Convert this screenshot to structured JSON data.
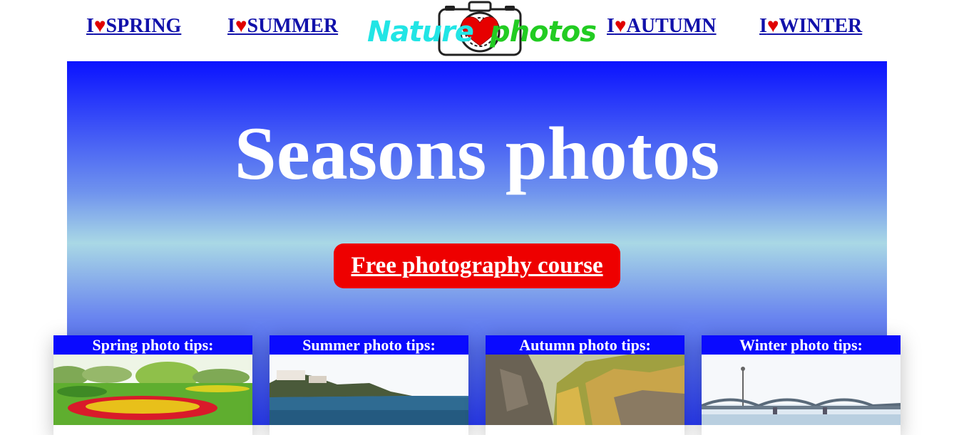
{
  "nav": {
    "spring": {
      "prefix": "I",
      "heart": "♥",
      "label": "SPRING"
    },
    "summer": {
      "prefix": "I",
      "heart": "♥",
      "label": "SUMMER"
    },
    "autumn": {
      "prefix": "I",
      "heart": "♥",
      "label": "AUTUMN"
    },
    "winter": {
      "prefix": "I",
      "heart": "♥",
      "label": "WINTER"
    }
  },
  "logo": {
    "text_a": "Nature",
    "text_b": "photos",
    "icon": "camera-heart-icon"
  },
  "hero": {
    "title": "Seasons photos",
    "button_label": "Free photography course"
  },
  "cards": {
    "spring": {
      "title": "Spring photo tips:"
    },
    "summer": {
      "title": "Summer photo tips:"
    },
    "autumn": {
      "title": "Autumn photo tips:"
    },
    "winter": {
      "title": "Winter photo tips:"
    }
  },
  "colors": {
    "nav_link": "#1111aa",
    "heart": "#e00000",
    "hero_top": "#0a12ff",
    "hero_mid": "#a9d8e5",
    "button": "#ee0000",
    "card_title_bg": "#0a0aff"
  }
}
